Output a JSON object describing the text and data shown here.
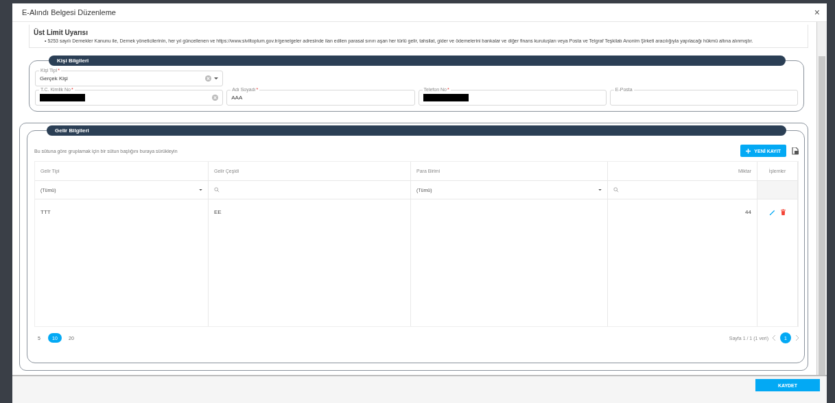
{
  "window": {
    "title": "E-Alındı Belgesi Düzenleme",
    "close": "×"
  },
  "warning": {
    "title": "Üst Limit Uyarısı",
    "text": "• 5253 sayılı Dernekler Kanunu ile, Dernek yöneticilerinin, her yıl güncellenen ve https://www.siviltoplum.gov.tr/genelgeler adresinde ilan edilen parasal sınırı aşan her türlü gelir, tahsilat, gider ve ödemelerini bankalar ve diğer finans kuruluşları veya Posta ve Telgraf Teşkilatı Anonim Şirketi aracılığıyla yapılacağı hükmü altına alınmıştır."
  },
  "person_section": {
    "title": "Kişi Bilgileri",
    "fields": [
      {
        "kind": "select",
        "label": "Kişi Tipi",
        "required_mark": "*",
        "value": "Gerçek Kişi",
        "clearable": true
      },
      {
        "kind": "redacted",
        "label": "T.C. Kimlik No",
        "required_mark": "*",
        "clearable": true
      },
      {
        "kind": "text",
        "label": "Adı Soyadı",
        "required_mark": "*",
        "value": "AAA"
      },
      {
        "kind": "redacted",
        "label": "Telefon No",
        "required_mark": "*",
        "clearable": false
      },
      {
        "kind": "text",
        "label": "E-Posta"
      }
    ]
  },
  "income_section": {
    "title": "Gelir Bilgileri",
    "group_hint": "Bu sütuna göre gruplamak için bir sütun başlığını buraya sürükleyin",
    "add_button": "YENİ KAYIT",
    "columns": [
      {
        "label": "Gelir Tipi"
      },
      {
        "label": "Gelir Çeşidi"
      },
      {
        "label": "Para Birimi"
      },
      {
        "label": "Miktar"
      },
      {
        "label": "İşlemler"
      }
    ],
    "filters": [
      {
        "kind": "select",
        "value": "(Tümü)"
      },
      {
        "kind": "search"
      },
      {
        "kind": "select",
        "value": "(Tümü)"
      },
      {
        "kind": "search"
      },
      {
        "kind": "empty"
      }
    ],
    "rows": [
      {
        "gelir_tipi": "TTT",
        "gelir_cesidi": "EE",
        "miktar": "44"
      }
    ],
    "page_sizes": [
      {
        "label": "5",
        "selected": false
      },
      {
        "label": "10",
        "selected": true
      },
      {
        "label": "20",
        "selected": false
      }
    ],
    "page_info": "Sayfa 1 / 1 (1 veri)",
    "pages": [
      {
        "label": "1",
        "selected": true
      }
    ]
  },
  "footer": {
    "save_button": "KAYDET"
  }
}
